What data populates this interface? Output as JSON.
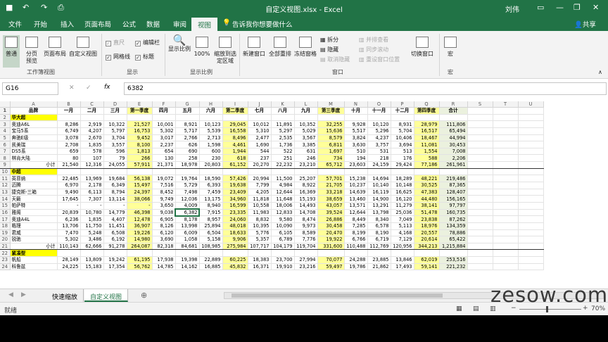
{
  "window": {
    "title": "自定义视图.xlsx - Excel",
    "user": "刘伟"
  },
  "tabs": [
    "文件",
    "开始",
    "插入",
    "页面布局",
    "公式",
    "数据",
    "审阅",
    "视图"
  ],
  "tell_me": "告诉我你想要做什么",
  "share": "共享",
  "ribbon": {
    "views": [
      "普通",
      "分页预览",
      "页面布局",
      "自定义视图"
    ],
    "views_group": "工作簿视图",
    "show_items": [
      {
        "label": "直尺",
        "checked": true,
        "disabled": true
      },
      {
        "label": "编辑栏",
        "checked": true
      },
      {
        "label": "网格线",
        "checked": true
      },
      {
        "label": "标题",
        "checked": true
      }
    ],
    "show_group": "显示",
    "zoom_items": [
      "显示比例",
      "100%",
      "缩放到选定区域"
    ],
    "zoom_group": "显示比例",
    "window_items": [
      "新建窗口",
      "全部重排",
      "冻结窗格",
      "拆分",
      "隐藏",
      "取消隐藏",
      "并排查看",
      "同步滚动",
      "重设窗口位置",
      "切换窗口"
    ],
    "window_group": "窗口",
    "macro": "宏",
    "macro_group": "宏"
  },
  "formula": {
    "cell": "G16",
    "value": "6382"
  },
  "columns": [
    "A",
    "B",
    "C",
    "D",
    "E",
    "F",
    "G",
    "H",
    "I",
    "J",
    "K",
    "L",
    "M",
    "N",
    "O",
    "P",
    "Q",
    "R",
    "S",
    "T",
    "U"
  ],
  "headers": [
    "品牌",
    "一月",
    "二月",
    "三月",
    "第一季度",
    "四月",
    "五月",
    "六月",
    "第二季度",
    "七月",
    "八月",
    "九月",
    "第三季度",
    "十月",
    "十一月",
    "十二月",
    "第四季度",
    "合计"
  ],
  "rows": [
    {
      "n": "2",
      "type": "sec",
      "cells": [
        "华大超"
      ]
    },
    {
      "n": "3",
      "cells": [
        "奥迪A6L",
        "8,286",
        "2,919",
        "10,322",
        "21,527",
        "10,001",
        "8,921",
        "10,123",
        "29,045",
        "10,012",
        "11,891",
        "10,352",
        "32,255",
        "9,928",
        "10,120",
        "8,931",
        "28,979",
        "111,806"
      ]
    },
    {
      "n": "4",
      "cells": [
        "宝马5系",
        "6,749",
        "4,207",
        "5,797",
        "16,753",
        "5,302",
        "5,717",
        "5,539",
        "16,558",
        "5,310",
        "5,297",
        "5,029",
        "15,636",
        "5,517",
        "5,296",
        "5,704",
        "16,517",
        "65,494"
      ]
    },
    {
      "n": "5",
      "cells": [
        "奔驰E级",
        "3,078",
        "2,670",
        "3,704",
        "9,452",
        "3,017",
        "2,766",
        "2,713",
        "8,496",
        "2,477",
        "2,535",
        "3,567",
        "8,579",
        "3,824",
        "4,237",
        "10,406",
        "18,467",
        "44,994"
      ]
    },
    {
      "n": "6",
      "cells": [
        "凯美瑞",
        "2,708",
        "1,835",
        "3,557",
        "8,100",
        "2,237",
        "626",
        "1,598",
        "4,461",
        "1,690",
        "1,736",
        "3,385",
        "6,811",
        "3,630",
        "3,757",
        "3,694",
        "11,081",
        "30,453"
      ]
    },
    {
      "n": "7",
      "cells": [
        "DS5系",
        "659",
        "578",
        "596",
        "1,813",
        "654",
        "690",
        "600",
        "1,944",
        "544",
        "522",
        "631",
        "1,697",
        "510",
        "531",
        "513",
        "1,554",
        "7,008"
      ]
    },
    {
      "n": "8",
      "cells": [
        "林肯大陆",
        "80",
        "107",
        "79",
        "266",
        "130",
        "258",
        "230",
        "618",
        "237",
        "251",
        "246",
        "734",
        "194",
        "218",
        "176",
        "588",
        "2,206"
      ]
    },
    {
      "n": "9",
      "type": "total",
      "cells": [
        "小计",
        "21,540",
        "12,316",
        "24,055",
        "57,911",
        "21,371",
        "18,978",
        "20,803",
        "61,152",
        "20,270",
        "22,232",
        "23,210",
        "65,712",
        "23,603",
        "24,159",
        "29,424",
        "77,186",
        "261,961"
      ]
    },
    {
      "n": "10",
      "type": "sec",
      "cells": [
        "中超"
      ]
    },
    {
      "n": "11",
      "cells": [
        "英菲纳",
        "22,485",
        "13,969",
        "19,684",
        "56,138",
        "19,072",
        "19,764",
        "18,590",
        "57,426",
        "20,994",
        "11,500",
        "25,207",
        "57,701",
        "15,238",
        "14,694",
        "18,289",
        "48,221",
        "219,486"
      ]
    },
    {
      "n": "12",
      "cells": [
        "迈腾",
        "6,970",
        "2,178",
        "6,349",
        "15,497",
        "7,516",
        "5,729",
        "6,393",
        "19,638",
        "7,799",
        "4,984",
        "8,922",
        "21,705",
        "10,237",
        "10,140",
        "10,148",
        "30,525",
        "87,365"
      ]
    },
    {
      "n": "13",
      "cells": [
        "捷克斯-三箱",
        "9,490",
        "6,113",
        "8,794",
        "24,397",
        "8,452",
        "7,498",
        "7,459",
        "23,409",
        "4,205",
        "12,644",
        "16,369",
        "33,218",
        "14,639",
        "16,119",
        "16,625",
        "47,383",
        "128,407"
      ]
    },
    {
      "n": "14",
      "cells": [
        "天籁",
        "17,645",
        "7,307",
        "13,114",
        "38,066",
        "9,749",
        "12,036",
        "13,175",
        "34,960",
        "11,818",
        "11,648",
        "15,193",
        "38,659",
        "13,460",
        "14,900",
        "16,120",
        "44,480",
        "156,165"
      ]
    },
    {
      "n": "15",
      "cells": [
        "帕萨特",
        "-",
        "-",
        "-",
        "-",
        "3,650",
        "4,009",
        "8,940",
        "16,599",
        "10,558",
        "18,006",
        "14,493",
        "43,057",
        "13,571",
        "13,291",
        "11,279",
        "38,141",
        "97,797"
      ]
    },
    {
      "n": "16",
      "cells": [
        "雅阁",
        "20,839",
        "10,780",
        "14,779",
        "46,398",
        "9,038",
        "6,382",
        "7,915",
        "23,335",
        "11,983",
        "12,833",
        "14,708",
        "39,524",
        "12,644",
        "13,798",
        "25,036",
        "51,478",
        "160,735"
      ]
    },
    {
      "n": "17",
      "cells": [
        "奥迪A4L",
        "6,236",
        "1,835",
        "4,407",
        "12,478",
        "6,905",
        "8,178",
        "8,957",
        "24,060",
        "8,832",
        "9,580",
        "8,474",
        "26,886",
        "8,449",
        "8,340",
        "7,049",
        "23,838",
        "87,262"
      ]
    },
    {
      "n": "18",
      "cells": [
        "皓理",
        "13,706",
        "11,750",
        "11,451",
        "36,907",
        "8,126",
        "13,998",
        "25,894",
        "48,018",
        "10,395",
        "10,090",
        "9,973",
        "30,458",
        "7,285",
        "6,578",
        "5,113",
        "18,976",
        "134,359"
      ]
    },
    {
      "n": "19",
      "cells": [
        "君威",
        "7,470",
        "5,248",
        "6,508",
        "19,226",
        "6,120",
        "6,009",
        "6,504",
        "18,633",
        "5,776",
        "6,105",
        "8,589",
        "20,470",
        "8,199",
        "8,190",
        "4,168",
        "20,557",
        "78,886"
      ]
    },
    {
      "n": "20",
      "cells": [
        "锐驰",
        "5,302",
        "3,486",
        "6,192",
        "14,980",
        "3,690",
        "1,058",
        "5,158",
        "9,906",
        "5,357",
        "6,789",
        "7,776",
        "19,922",
        "6,766",
        "6,719",
        "7,129",
        "20,614",
        "65,422"
      ]
    },
    {
      "n": "21",
      "type": "total",
      "cells": [
        "小计",
        "110,143",
        "62,666",
        "91,278",
        "264,087",
        "82,318",
        "84,681",
        "108,985",
        "275,984",
        "107,717",
        "104,179",
        "119,704",
        "331,600",
        "110,488",
        "112,769",
        "120,956",
        "344,213",
        "1,215,884"
      ]
    },
    {
      "n": "22",
      "type": "sec",
      "cells": [
        "紧凑型"
      ]
    },
    {
      "n": "23",
      "cells": [
        "帆船",
        "28,149",
        "13,809",
        "19,242",
        "61,195",
        "17,938",
        "19,398",
        "22,889",
        "60,225",
        "18,383",
        "23,700",
        "27,994",
        "70,077",
        "24,288",
        "23,885",
        "13,846",
        "62,019",
        "253,516"
      ]
    },
    {
      "n": "24",
      "cells": [
        "科鲁兹",
        "24,225",
        "15,183",
        "17,354",
        "56,762",
        "14,785",
        "14,162",
        "16,885",
        "45,832",
        "16,371",
        "19,910",
        "23,216",
        "59,497",
        "19,786",
        "21,862",
        "17,493",
        "59,141",
        "221,232"
      ]
    }
  ],
  "sheets": [
    "快速缩放",
    "自定义视图"
  ],
  "status": {
    "mode": "就绪",
    "zoom": "70%"
  },
  "watermark": "zesow.com"
}
